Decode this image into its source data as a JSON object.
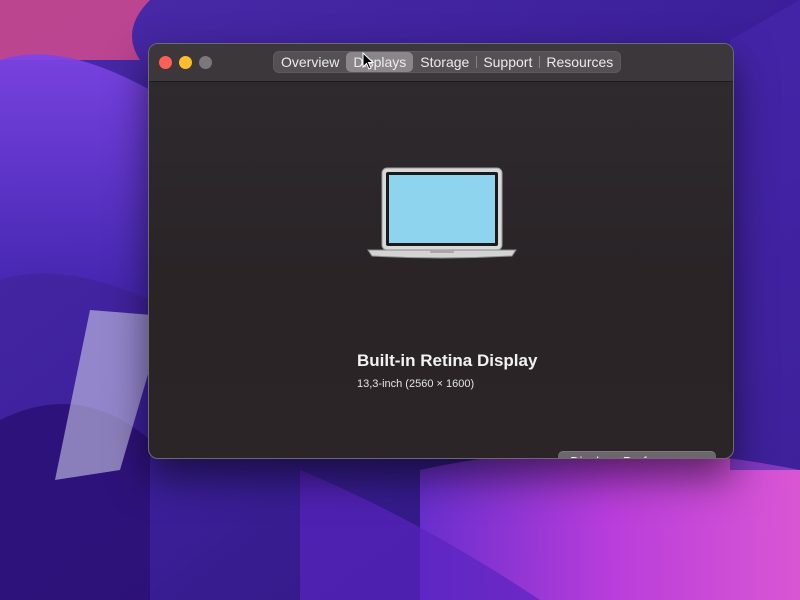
{
  "window": {
    "tabs": [
      {
        "label": "Overview",
        "active": false
      },
      {
        "label": "Displays",
        "active": true
      },
      {
        "label": "Storage",
        "active": false
      },
      {
        "label": "Support",
        "active": false
      },
      {
        "label": "Resources",
        "active": false
      }
    ]
  },
  "display": {
    "name": "Built-in Retina Display",
    "spec": "13,3-inch (2560 × 1600)",
    "icon": "laptop-icon",
    "screen_color": "#8fd4ef"
  },
  "buttons": {
    "preferences_label": "Displays Preferences..."
  },
  "colors": {
    "close": "#ff5f57",
    "minimize": "#febc2e",
    "zoom": "#7b787c"
  }
}
